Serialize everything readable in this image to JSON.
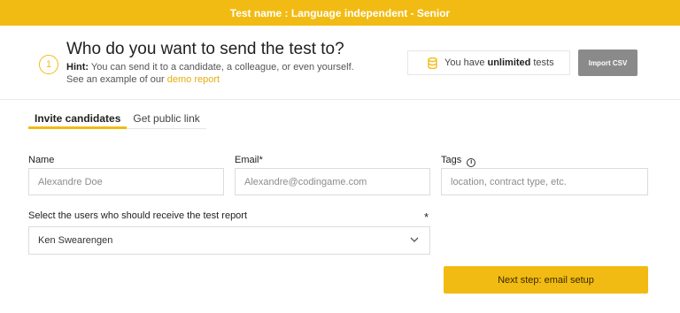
{
  "topbar": {
    "title": "Test name : Language independent - Senior"
  },
  "header": {
    "step_number": "1",
    "title": "Who do you want to send the test to?",
    "hint_label": "Hint:",
    "hint_text": " You can send it to a candidate, a colleague, or even yourself.",
    "example_prefix": "See an example of our ",
    "example_link": "demo report",
    "quota_prefix": "You have",
    "quota_value": "unlimited",
    "quota_suffix": "tests",
    "quota_icon": "coin-stack-icon",
    "import_button": "Import CSV"
  },
  "tabs": [
    {
      "label": "Invite candidates",
      "active": true
    },
    {
      "label": "Get public link",
      "active": false
    }
  ],
  "form": {
    "name_label": "Name",
    "name_placeholder": "Alexandre Doe",
    "email_label": "Email*",
    "email_placeholder": "Alexandre@codingame.com",
    "tags_label": "Tags",
    "tags_placeholder": "location, contract type, etc.",
    "report_label": "Select the users who should receive the test report",
    "report_required": "*",
    "report_selected": "Ken Swearengen"
  },
  "actions": {
    "next_button": "Next step: email setup"
  },
  "colors": {
    "accent": "#f2bb13",
    "button_gray": "#8a8a8a"
  }
}
